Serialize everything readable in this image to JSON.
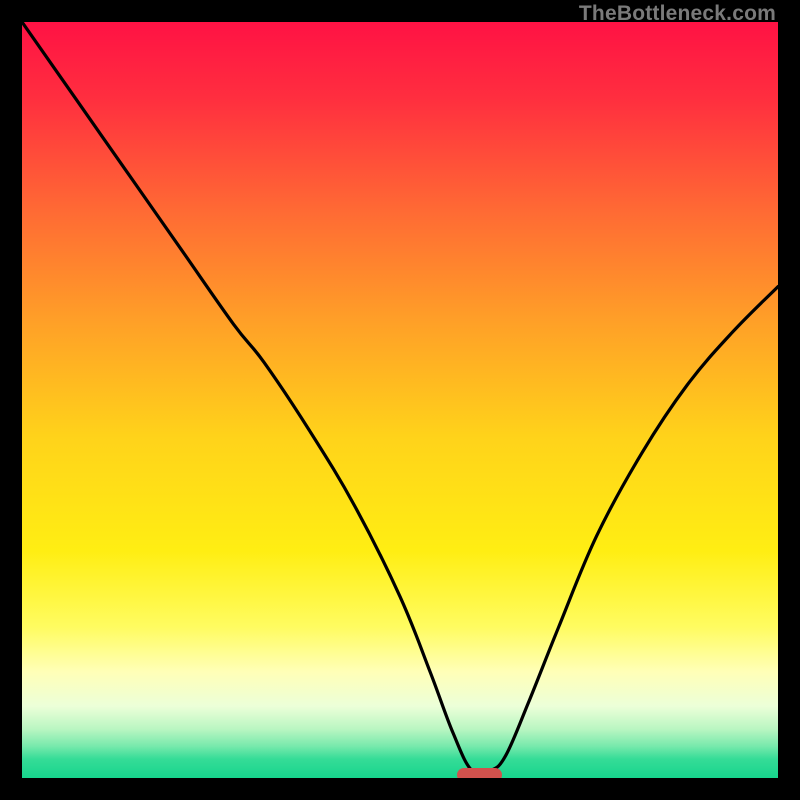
{
  "watermark": "TheBottleneck.com",
  "chart_data": {
    "type": "line",
    "title": "",
    "xlabel": "",
    "ylabel": "",
    "xlim": [
      0,
      100
    ],
    "ylim": [
      0,
      100
    ],
    "grid": false,
    "legend": false,
    "gradient_stops": [
      {
        "pos": 0.0,
        "color": "#ff1244"
      },
      {
        "pos": 0.1,
        "color": "#ff2e3f"
      },
      {
        "pos": 0.25,
        "color": "#ff6a34"
      },
      {
        "pos": 0.4,
        "color": "#ffa127"
      },
      {
        "pos": 0.55,
        "color": "#ffd31a"
      },
      {
        "pos": 0.7,
        "color": "#ffee13"
      },
      {
        "pos": 0.8,
        "color": "#fffc60"
      },
      {
        "pos": 0.86,
        "color": "#ffffb8"
      },
      {
        "pos": 0.905,
        "color": "#ecffd8"
      },
      {
        "pos": 0.935,
        "color": "#baf6c2"
      },
      {
        "pos": 0.958,
        "color": "#77e9ac"
      },
      {
        "pos": 0.975,
        "color": "#35dc97"
      },
      {
        "pos": 1.0,
        "color": "#17d58d"
      }
    ],
    "series": [
      {
        "name": "bottleneck-curve",
        "color": "#000000",
        "x": [
          0,
          7,
          14,
          21,
          28,
          32,
          38,
          44,
          50,
          54,
          57,
          59.5,
          62,
          64,
          67,
          71,
          76,
          82,
          88,
          94,
          100
        ],
        "y": [
          100,
          90,
          80,
          70,
          60,
          55,
          46,
          36,
          24,
          14,
          6,
          1,
          1,
          3,
          10,
          20,
          32,
          43,
          52,
          59,
          65
        ]
      }
    ],
    "marker": {
      "x_center": 60.5,
      "y": 0.4,
      "width_pct": 6.0,
      "height_pct": 1.9,
      "color": "#d1524d"
    }
  }
}
